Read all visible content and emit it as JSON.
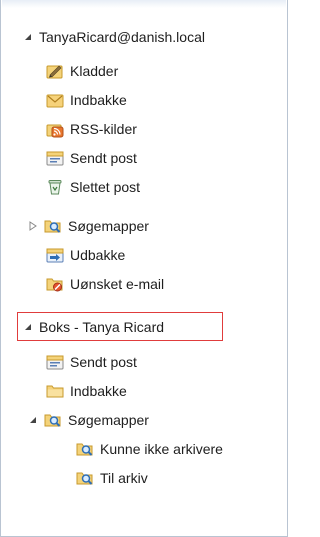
{
  "window": {
    "title": ""
  },
  "account": {
    "name": "TanyaRicard@danish.local",
    "folders": [
      {
        "label": "Kladder",
        "icon": "drafts-icon"
      },
      {
        "label": "Indbakke",
        "icon": "inbox-icon"
      },
      {
        "label": "RSS-kilder",
        "icon": "rss-icon"
      },
      {
        "label": "Sendt post",
        "icon": "sent-icon"
      },
      {
        "label": "Slettet post",
        "icon": "deleted-icon"
      },
      {
        "label": "Søgemapper",
        "icon": "search-folder-icon"
      },
      {
        "label": "Udbakke",
        "icon": "outbox-icon"
      },
      {
        "label": "Uønsket e-mail",
        "icon": "junk-icon"
      }
    ]
  },
  "mailbox": {
    "name": "Boks - Tanya Ricard",
    "folders": [
      {
        "label": "Sendt post",
        "icon": "sent-icon"
      },
      {
        "label": "Indbakke",
        "icon": "folder-icon"
      },
      {
        "label": "Søgemapper",
        "icon": "search-folder-icon"
      },
      {
        "label": "Kunne ikke arkivere",
        "icon": "search-folder-icon"
      },
      {
        "label": "Til arkiv",
        "icon": "search-folder-icon"
      }
    ]
  },
  "colors": {
    "highlight_border": "#e03c3c",
    "pane_border": "#b9c4d2",
    "text": "#1e1e1e"
  }
}
